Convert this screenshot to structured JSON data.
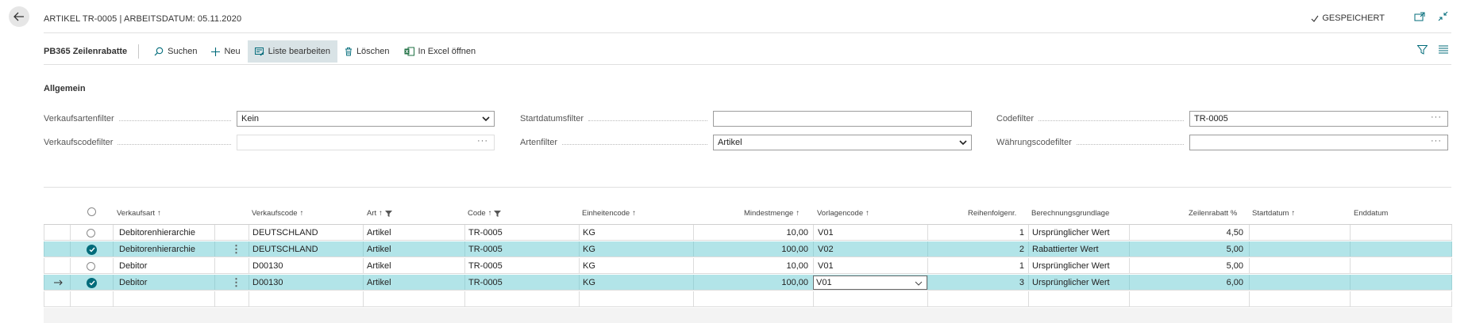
{
  "header": {
    "title": "ARTIKEL TR-0005 | ARBEITSDATUM: 05.11.2020",
    "saved_label": "GESPEICHERT"
  },
  "actionbar": {
    "page_name": "PB365 Zeilenrabatte",
    "actions": {
      "search": "Suchen",
      "new": "Neu",
      "edit_list": "Liste bearbeiten",
      "delete": "Löschen",
      "excel": "In Excel öffnen"
    }
  },
  "general": {
    "section_title": "Allgemein",
    "fields": {
      "sales_type_filter": {
        "label": "Verkaufsartenfilter",
        "value": "Kein"
      },
      "sales_code_filter": {
        "label": "Verkaufscodefilter",
        "value": ""
      },
      "start_date_filter": {
        "label": "Startdatumsfilter",
        "value": ""
      },
      "type_filter": {
        "label": "Artenfilter",
        "value": "Artikel"
      },
      "code_filter": {
        "label": "Codefilter",
        "value": "TR-0005"
      },
      "currency_code_filter": {
        "label": "Währungscodefilter",
        "value": ""
      }
    }
  },
  "grid": {
    "columns": {
      "verkaufsart": "Verkaufsart",
      "verkaufscode": "Verkaufscode",
      "art": "Art",
      "code": "Code",
      "einheitencode": "Einheitencode",
      "mindestmenge": "Mindestmenge",
      "vorlagencode": "Vorlagencode",
      "reihenfolge": "Reihenfolgenr.",
      "berechnung": "Berechnungsgrundlage",
      "zeilenrabatt": "Zeilenrabatt %",
      "startdatum": "Startdatum",
      "enddatum": "Enddatum"
    },
    "rows": [
      {
        "verkaufsart": "Debitorenhierarchie",
        "verkaufscode": "DEUTSCHLAND",
        "art": "Artikel",
        "code": "TR-0005",
        "einheitencode": "KG",
        "mindestmenge": "10,00",
        "vorlagencode": "V01",
        "reihenfolge": "1",
        "berechnung": "Ursprünglicher Wert",
        "zeilenrabatt": "4,50",
        "startdatum": "",
        "enddatum": ""
      },
      {
        "verkaufsart": "Debitorenhierarchie",
        "verkaufscode": "DEUTSCHLAND",
        "art": "Artikel",
        "code": "TR-0005",
        "einheitencode": "KG",
        "mindestmenge": "100,00",
        "vorlagencode": "V02",
        "reihenfolge": "2",
        "berechnung": "Rabattierter Wert",
        "zeilenrabatt": "5,00",
        "startdatum": "",
        "enddatum": ""
      },
      {
        "verkaufsart": "Debitor",
        "verkaufscode": "D00130",
        "art": "Artikel",
        "code": "TR-0005",
        "einheitencode": "KG",
        "mindestmenge": "10,00",
        "vorlagencode": "V01",
        "reihenfolge": "1",
        "berechnung": "Ursprünglicher Wert",
        "zeilenrabatt": "5,00",
        "startdatum": "",
        "enddatum": ""
      },
      {
        "verkaufsart": "Debitor",
        "verkaufscode": "D00130",
        "art": "Artikel",
        "code": "TR-0005",
        "einheitencode": "KG",
        "mindestmenge": "100,00",
        "vorlagencode": "V01",
        "reihenfolge": "3",
        "berechnung": "Ursprünglicher Wert",
        "zeilenrabatt": "6,00",
        "startdatum": "",
        "enddatum": ""
      }
    ]
  },
  "colors": {
    "accent": "#006b7a",
    "selected_row": "#b2e4e8",
    "active_action": "#d9e3e6"
  }
}
